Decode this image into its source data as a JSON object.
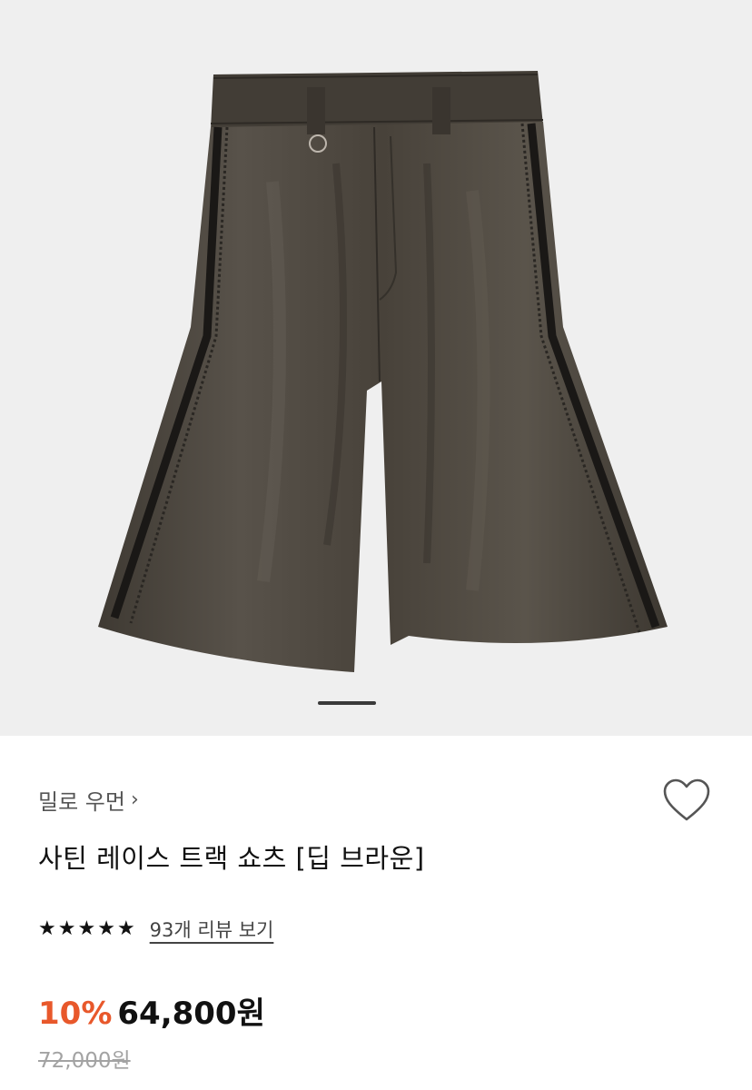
{
  "product": {
    "image_alt": "Satin lace track shorts in deep brown",
    "image_pager_index": 1,
    "brand_label": "밀로 우먼",
    "brand_chevron": "›",
    "title": "사틴 레이스 트랙 쇼츠 [딥 브라운]",
    "rating": {
      "stars": 5,
      "star_glyph": "★",
      "review_link": "93개 리뷰 보기"
    },
    "price": {
      "discount": "10%",
      "sale_price": "64,800원",
      "original_price": "72,000원"
    },
    "wishlist_icon": "heart-outline-icon",
    "colors": {
      "discount": "#e8582b",
      "hero_bg": "#efefef",
      "fabric": "#4a443c"
    }
  }
}
